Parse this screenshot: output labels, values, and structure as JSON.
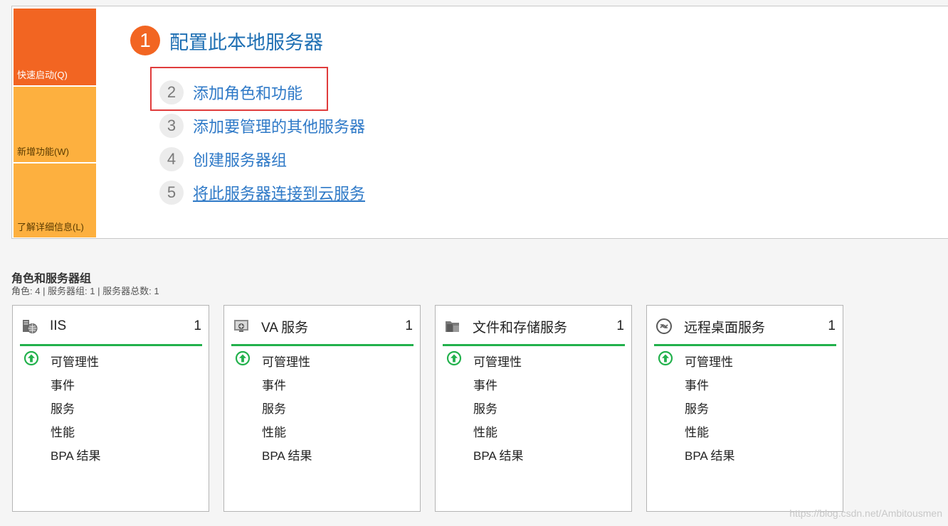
{
  "tiles": {
    "quick_start": "快速启动(Q)",
    "new_features": "新增功能(W)",
    "learn_more": "了解详细信息(L)"
  },
  "welcome": {
    "main_step": {
      "number": "1",
      "title": "配置此本地服务器"
    },
    "steps": [
      {
        "number": "2",
        "label": "添加角色和功能"
      },
      {
        "number": "3",
        "label": "添加要管理的其他服务器"
      },
      {
        "number": "4",
        "label": "创建服务器组"
      },
      {
        "number": "5",
        "label": "将此服务器连接到云服务"
      }
    ]
  },
  "section": {
    "title": "角色和服务器组",
    "summary": "角色: 4 | 服务器组: 1 | 服务器总数: 1"
  },
  "cards": [
    {
      "name": "IIS",
      "count": "1",
      "icon": "iis-icon",
      "items": [
        "可管理性",
        "事件",
        "服务",
        "性能",
        "BPA 结果"
      ]
    },
    {
      "name": "VA 服务",
      "count": "1",
      "icon": "va-service-icon",
      "items": [
        "可管理性",
        "事件",
        "服务",
        "性能",
        "BPA 结果"
      ]
    },
    {
      "name": "文件和存储服务",
      "count": "1",
      "icon": "file-storage-icon",
      "items": [
        "可管理性",
        "事件",
        "服务",
        "性能",
        "BPA 结果"
      ]
    },
    {
      "name": "远程桌面服务",
      "count": "1",
      "icon": "remote-desktop-icon",
      "items": [
        "可管理性",
        "事件",
        "服务",
        "性能",
        "BPA 结果"
      ]
    }
  ],
  "colors": {
    "accent_orange": "#f26522",
    "tile_yellow": "#fdb03f",
    "link_blue": "#2e79c7",
    "status_green": "#22b14c",
    "highlight_red": "#e03c3c"
  },
  "watermark": "https://blog.csdn.net/Ambitousmen"
}
